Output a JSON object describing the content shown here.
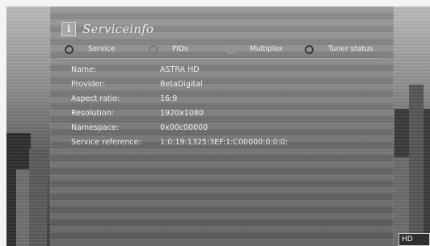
{
  "header": {
    "title": "Serviceinfo",
    "info_icon": "info-icon"
  },
  "tabs": [
    {
      "label": "Service",
      "radio_style": "dark"
    },
    {
      "label": "PIDs",
      "radio_style": "mid"
    },
    {
      "label": "Multiplex",
      "radio_style": "light"
    },
    {
      "label": "Tuner status",
      "radio_style": "dark"
    }
  ],
  "info_rows": [
    {
      "key": "Name:",
      "value": "ASTRA HD"
    },
    {
      "key": "Provider:",
      "value": "BetaDigital"
    },
    {
      "key": "Aspect ratio:",
      "value": "16:9"
    },
    {
      "key": "Resolution:",
      "value": "1920x1080"
    },
    {
      "key": "Namespace:",
      "value": "0x00c00000"
    },
    {
      "key": "Service reference:",
      "value": "1:0:19:1325:3EF:1:C00000:0:0:0:"
    }
  ],
  "badge": {
    "label": "HD"
  },
  "colors": {
    "panel": "#787878",
    "text": "#efefef",
    "badge_bg": "#2f2f2f"
  }
}
